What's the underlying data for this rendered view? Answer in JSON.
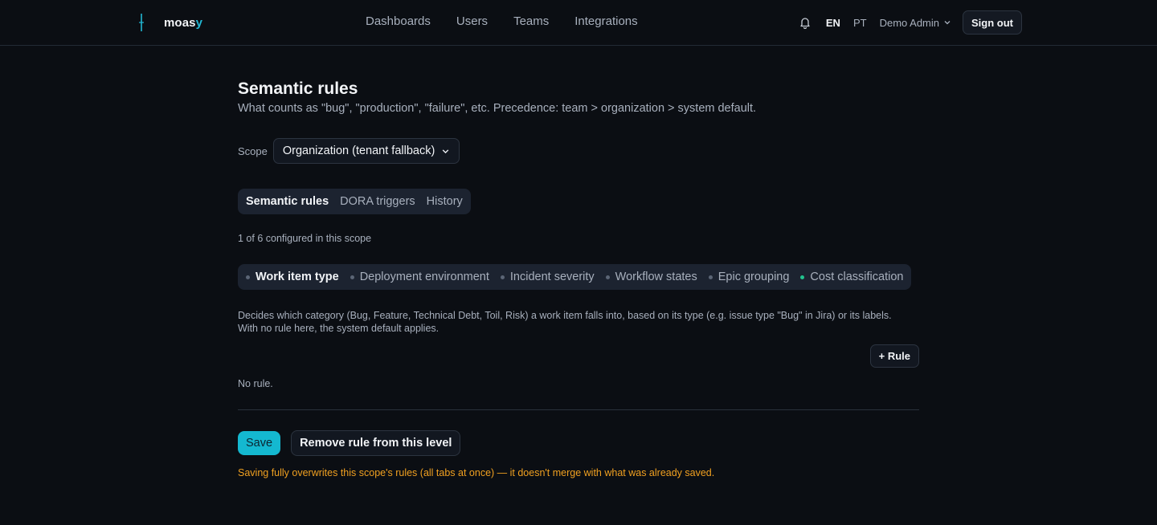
{
  "brand": {
    "name_prefix": "moas",
    "name_accent": "y",
    "accent_color": "#22b8d4"
  },
  "nav": {
    "items": [
      "Dashboards",
      "Users",
      "Teams",
      "Integrations"
    ]
  },
  "header_right": {
    "notification_icon": "bell-icon",
    "languages": [
      {
        "label": "EN",
        "active": true
      },
      {
        "label": "PT",
        "active": false
      }
    ],
    "user_label": "Demo Admin",
    "signout_label": "Sign out"
  },
  "page": {
    "title": "Semantic rules",
    "subtitle": "What counts as \"bug\", \"production\", \"failure\", etc. Precedence: team > organization > system default."
  },
  "scope": {
    "label": "Scope",
    "value": "Organization (tenant fallback)"
  },
  "section_tabs": [
    {
      "label": "Semantic rules",
      "active": true
    },
    {
      "label": "DORA triggers",
      "active": false
    },
    {
      "label": "History",
      "active": false
    }
  ],
  "configured_count": "1 of 6 configured in this scope",
  "rule_tabs": [
    {
      "label": "Work item type",
      "active": true,
      "configured": false
    },
    {
      "label": "Deployment environment",
      "active": false,
      "configured": false
    },
    {
      "label": "Incident severity",
      "active": false,
      "configured": false
    },
    {
      "label": "Workflow states",
      "active": false,
      "configured": false
    },
    {
      "label": "Epic grouping",
      "active": false,
      "configured": false
    },
    {
      "label": "Cost classification",
      "active": false,
      "configured": true
    }
  ],
  "description": {
    "line1": "Decides which category (Bug, Feature, Technical Debt, Toil, Risk) a work item falls into, based on its type (e.g. issue type \"Bug\" in Jira) or its labels.",
    "line2": "With no rule here, the system default applies."
  },
  "add_rule_label": "+ Rule",
  "empty_state": "No rule.",
  "actions": {
    "save_label": "Save",
    "remove_label": "Remove rule from this level",
    "warning": "Saving fully overwrites this scope's rules (all tabs at once) — it doesn't merge with what was already saved."
  },
  "colors": {
    "background": "#0b0e13",
    "save_button": "#14b8d0",
    "warning": "#f0a020",
    "configured_dot": "#22c38e"
  }
}
